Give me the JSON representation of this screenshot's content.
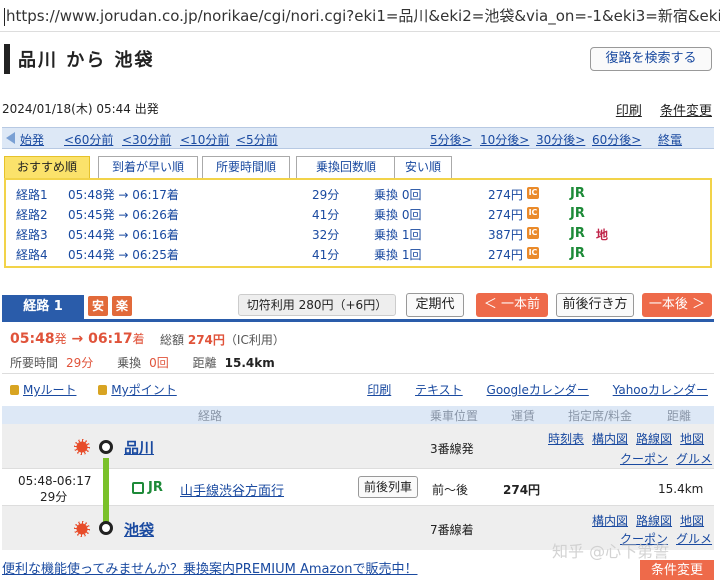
{
  "url": "https://www.jorudan.co.jp/norikae/cgi/nori.cgi?eki1=品川&eki2=池袋&via_on=-1&eki3=新宿&eki4=&e",
  "header": {
    "title": "品川 から 池袋",
    "reverse_button": "復路を検索する"
  },
  "search": {
    "datetime": "2024/01/18(木) 05:44 出発",
    "print": "印刷",
    "conditions": "条件変更"
  },
  "timenav": {
    "first": "始発",
    "m60": "<60分前",
    "m30": "<30分前",
    "m10": "<10分前",
    "m5": "<5分前",
    "p5": "5分後>",
    "p10": "10分後>",
    "p30": "30分後>",
    "p60": "60分後>",
    "last": "終電"
  },
  "tabs": [
    "おすすめ順",
    "到着が早い順",
    "所要時間順",
    "乗換回数順",
    "安い順"
  ],
  "routes": [
    {
      "name": "経路1",
      "time": "05:48発 → 06:17着",
      "duration": "29分",
      "transfer": "乗換 0回",
      "fare": "274円",
      "ic": "IC",
      "line": "JR",
      "sub": ""
    },
    {
      "name": "経路2",
      "time": "05:45発 → 06:26着",
      "duration": "41分",
      "transfer": "乗換 0回",
      "fare": "274円",
      "ic": "IC",
      "line": "JR",
      "sub": ""
    },
    {
      "name": "経路3",
      "time": "05:44発 → 06:16着",
      "duration": "32分",
      "transfer": "乗換 1回",
      "fare": "387円",
      "ic": "IC",
      "line": "JR",
      "sub": "地"
    },
    {
      "name": "経路4",
      "time": "05:44発 → 06:25着",
      "duration": "41分",
      "transfer": "乗換 1回",
      "fare": "274円",
      "ic": "IC",
      "line": "JR",
      "sub": ""
    }
  ],
  "detail": {
    "tab": "経路 1",
    "badge_safe": "安",
    "badge_easy": "楽",
    "teiki_fare": "切符利用 280円（+6円）",
    "pass_button": "定期代",
    "prev_button": "＜ 一本前",
    "around_button": "前後行き方",
    "next_button": "一本後 ＞",
    "dep": "05:48",
    "dep_suffix": "発",
    "arrow": "→",
    "arr": "06:17",
    "arr_suffix": "着",
    "fare_label": "総額",
    "fare_value": "274円",
    "fare_note": "（IC利用）",
    "duration_label": "所要時間",
    "duration_value": "29分",
    "transfer_label": "乗換",
    "transfer_value": "0回",
    "distance_label": "距離",
    "distance_value": "15.4km",
    "myroute": "Myルート",
    "mypoint": "Myポイント",
    "links": [
      "印刷",
      "テキスト",
      "Googleカレンダー",
      "Yahooカレンダー"
    ]
  },
  "table": {
    "headers": [
      "経路",
      "乗車位置",
      "運賃",
      "指定席/料金",
      "距離"
    ],
    "origin": {
      "name": "品川",
      "platform": "3番線発",
      "links": [
        "時刻表",
        "構内図",
        "路線図",
        "地図",
        "クーポン",
        "グルメ"
      ]
    },
    "segment": {
      "time": "05:48-06:17",
      "duration": "29分",
      "line_mark": "JR",
      "line_name": "山手線渋谷方面行",
      "around_train": "前後列車",
      "position": "前〜後",
      "fare": "274円",
      "distance": "15.4km"
    },
    "dest": {
      "name": "池袋",
      "platform": "7番線着",
      "links": [
        "構内図",
        "路線図",
        "地図",
        "クーポン",
        "グルメ"
      ]
    }
  },
  "footer": {
    "promo": "便利な機能使ってみませんか？乗換案内PREMIUM Amazonで販売中！",
    "conditions_button": "条件変更",
    "watermark": "知乎 @心下第誓"
  }
}
